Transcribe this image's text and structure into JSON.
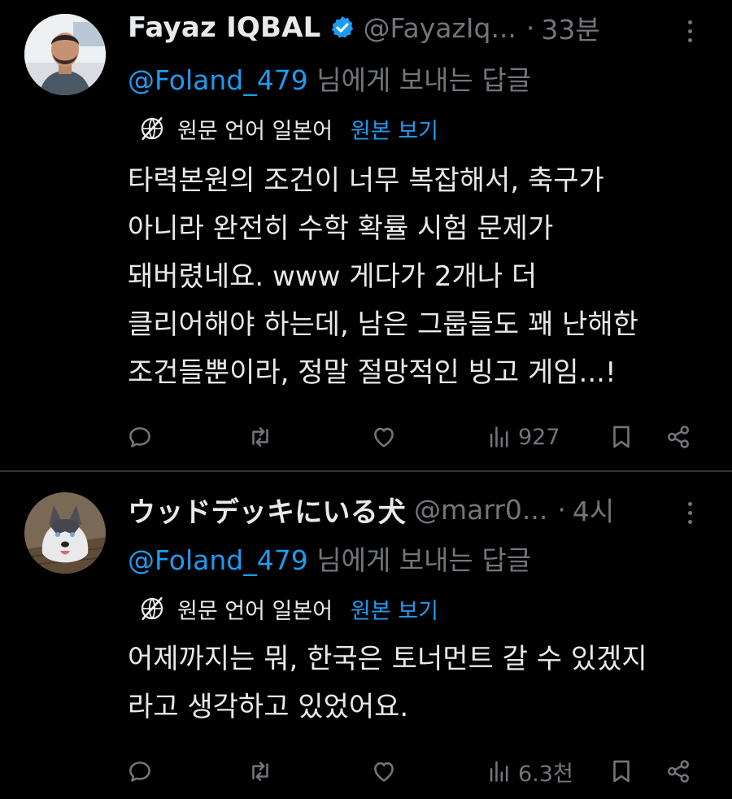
{
  "tweets": [
    {
      "name": "Fayaz IQBAL",
      "verified": true,
      "handle": "@FayazIq...",
      "separator": "·",
      "time": "33분",
      "reply_mention": "@Foland_479",
      "reply_suffix": " 님에게 보내는 답글",
      "translation_note": "원문 언어 일본어",
      "view_original": "원본 보기",
      "body": "타력본원의 조건이 너무 복잡해서, 축구가\n아니라 완전히 수학 확률 시험 문제가\n돼버렸네요. www 게다가 2개나 더\n클리어해야 하는데, 남은 그룹들도 꽤 난해한\n조건들뿐이라, 정말 절망적인 빙고 게임...!",
      "views": "927"
    },
    {
      "name": "ウッドデッキにいる犬",
      "verified": false,
      "handle": "@marr0...",
      "separator": "·",
      "time": "4시",
      "reply_mention": "@Foland_479",
      "reply_suffix": " 님에게 보내는 답글",
      "translation_note": "원문 언어 일본어",
      "view_original": "원본 보기",
      "body": "어제까지는 뭐, 한국은 토너먼트 갈 수 있겠지\n라고 생각하고 있었어요.",
      "views": "6.3천"
    }
  ],
  "colors": {
    "background": "#000000",
    "text": "#e7e9ea",
    "secondary": "#71767b",
    "accent": "#1d9bf0",
    "divider": "#2f3336"
  },
  "icons": {
    "reply": "reply-icon",
    "retweet": "retweet-icon",
    "like": "like-icon",
    "views": "views-icon",
    "bookmark": "bookmark-icon",
    "share": "share-icon",
    "translate": "translate-globe-icon",
    "more": "more-icon"
  }
}
